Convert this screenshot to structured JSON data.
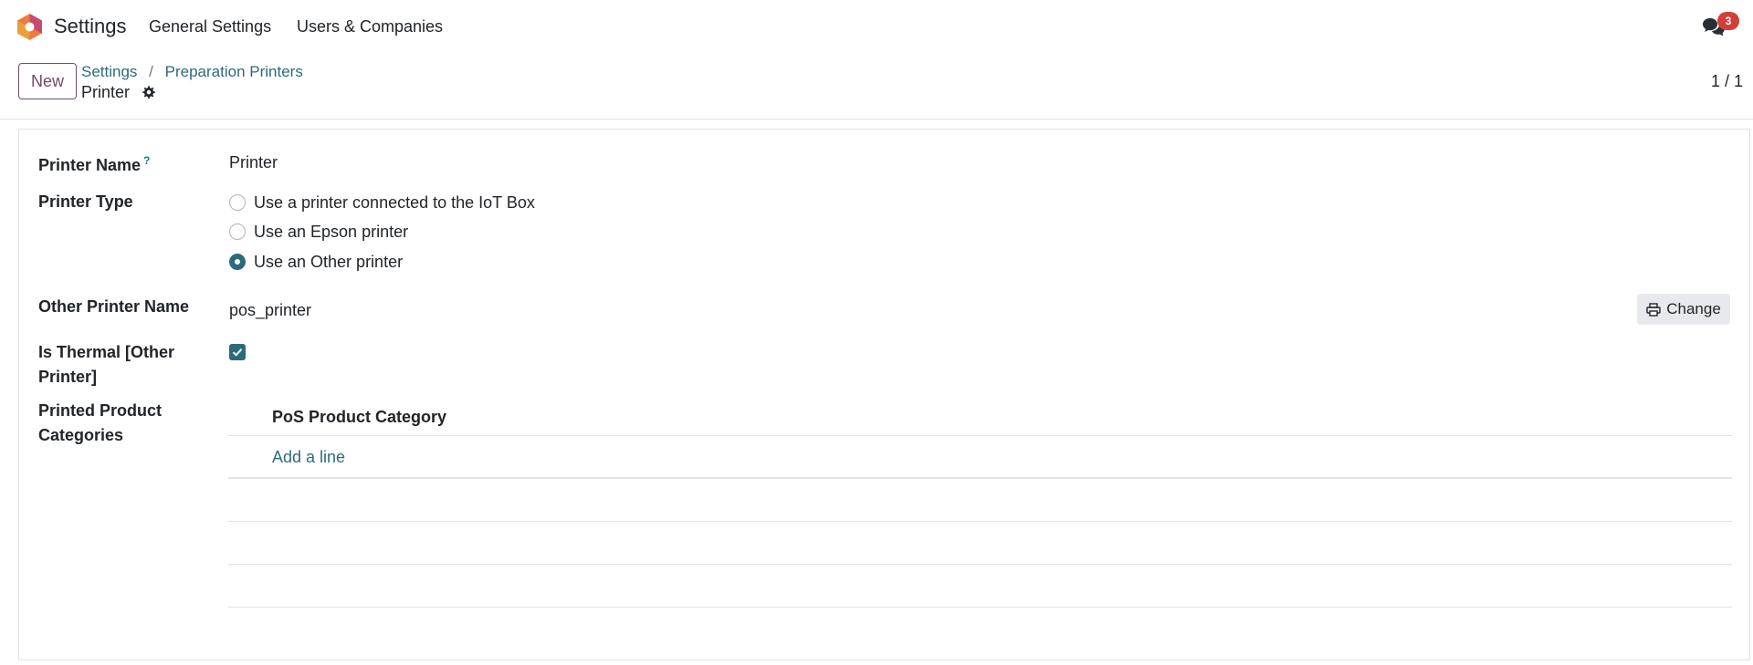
{
  "navbar": {
    "app_title": "Settings",
    "menus": [
      "General Settings",
      "Users & Companies"
    ],
    "chat_count": "3",
    "brand_colors": {
      "logo_orange": "#f07a3f",
      "logo_purple": "#714b67",
      "badge_red": "#d23f3a"
    }
  },
  "control_panel": {
    "new_label": "New",
    "breadcrumb": [
      "Settings",
      "Preparation Printers"
    ],
    "breadcrumb_separator": "/",
    "record_name": "Printer",
    "pager": "1 / 1"
  },
  "form": {
    "printer_name": {
      "label": "Printer Name",
      "help": "?",
      "value": "Printer"
    },
    "printer_type": {
      "label": "Printer Type",
      "options": [
        {
          "label": "Use a printer connected to the IoT Box",
          "checked": false
        },
        {
          "label": "Use an Epson printer",
          "checked": false
        },
        {
          "label": "Use an Other printer",
          "checked": true
        }
      ]
    },
    "other_printer_name": {
      "label": "Other Printer Name",
      "value": "pos_printer",
      "change_label": "Change"
    },
    "is_thermal": {
      "label_line1": "Is Thermal [Other",
      "label_line2": "Printer]",
      "checked": true
    },
    "categories": {
      "label_line1": "Printed Product",
      "label_line2": "Categories",
      "column": "PoS Product Category",
      "add_line": "Add a line"
    }
  },
  "accent_color": "#2c6b79"
}
